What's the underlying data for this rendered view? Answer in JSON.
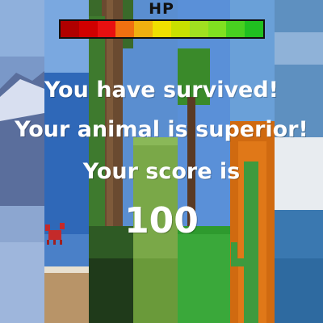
{
  "hud": {
    "hp_label": "HP",
    "hp_segments": [
      "#b00000",
      "#d00000",
      "#e81010",
      "#f07010",
      "#f0b010",
      "#f0e000",
      "#c8e000",
      "#a0e020",
      "#80e020",
      "#48d020",
      "#20c020"
    ],
    "hp_fill_fraction": 1.0
  },
  "game_over": {
    "line1": "You have survived!",
    "line2": "Your animal is superior!",
    "line3": "Your score is",
    "score": "100"
  },
  "colors": {
    "text": "#ffffff",
    "hp_border": "#111111"
  }
}
